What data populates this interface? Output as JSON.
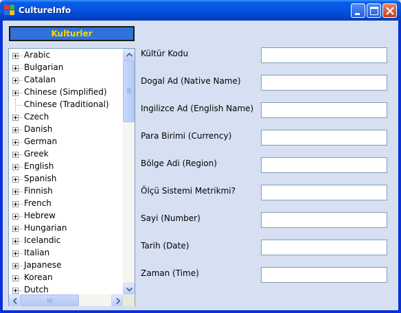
{
  "window": {
    "title": "CultureInfo",
    "title_color": "#ffffff",
    "titlebar_color": "#0454e2"
  },
  "kulturler_button": {
    "label": "Kulturler",
    "bg_color": "#2f72d8",
    "text_color": "#ffd700"
  },
  "tree": {
    "items": [
      {
        "label": "Arabic",
        "expandable": true
      },
      {
        "label": "Bulgarian",
        "expandable": true
      },
      {
        "label": "Catalan",
        "expandable": true
      },
      {
        "label": "Chinese (Simplified)",
        "expandable": true
      },
      {
        "label": "Chinese (Traditional)",
        "expandable": false
      },
      {
        "label": "Czech",
        "expandable": true
      },
      {
        "label": "Danish",
        "expandable": true
      },
      {
        "label": "German",
        "expandable": true
      },
      {
        "label": "Greek",
        "expandable": true
      },
      {
        "label": "English",
        "expandable": true
      },
      {
        "label": "Spanish",
        "expandable": true
      },
      {
        "label": "Finnish",
        "expandable": true
      },
      {
        "label": "French",
        "expandable": true
      },
      {
        "label": "Hebrew",
        "expandable": true
      },
      {
        "label": "Hungarian",
        "expandable": true
      },
      {
        "label": "Icelandic",
        "expandable": true
      },
      {
        "label": "Italian",
        "expandable": true
      },
      {
        "label": "Japanese",
        "expandable": true
      },
      {
        "label": "Korean",
        "expandable": true
      },
      {
        "label": "Dutch",
        "expandable": true
      }
    ]
  },
  "form": {
    "fields": [
      {
        "label": "Kültür Kodu",
        "value": ""
      },
      {
        "label": "Dogal Ad (Native Name)",
        "value": ""
      },
      {
        "label": "Ingilizce Ad (English Name)",
        "value": ""
      },
      {
        "label": "Para Birimi (Currency)",
        "value": ""
      },
      {
        "label": "Bölge Adi (Region)",
        "value": ""
      },
      {
        "label": "Ölçü Sistemi Metrikmi?",
        "value": ""
      },
      {
        "label": "Sayi (Number)",
        "value": ""
      },
      {
        "label": "Tarih (Date)",
        "value": ""
      },
      {
        "label": "Zaman (Time)",
        "value": ""
      }
    ]
  }
}
